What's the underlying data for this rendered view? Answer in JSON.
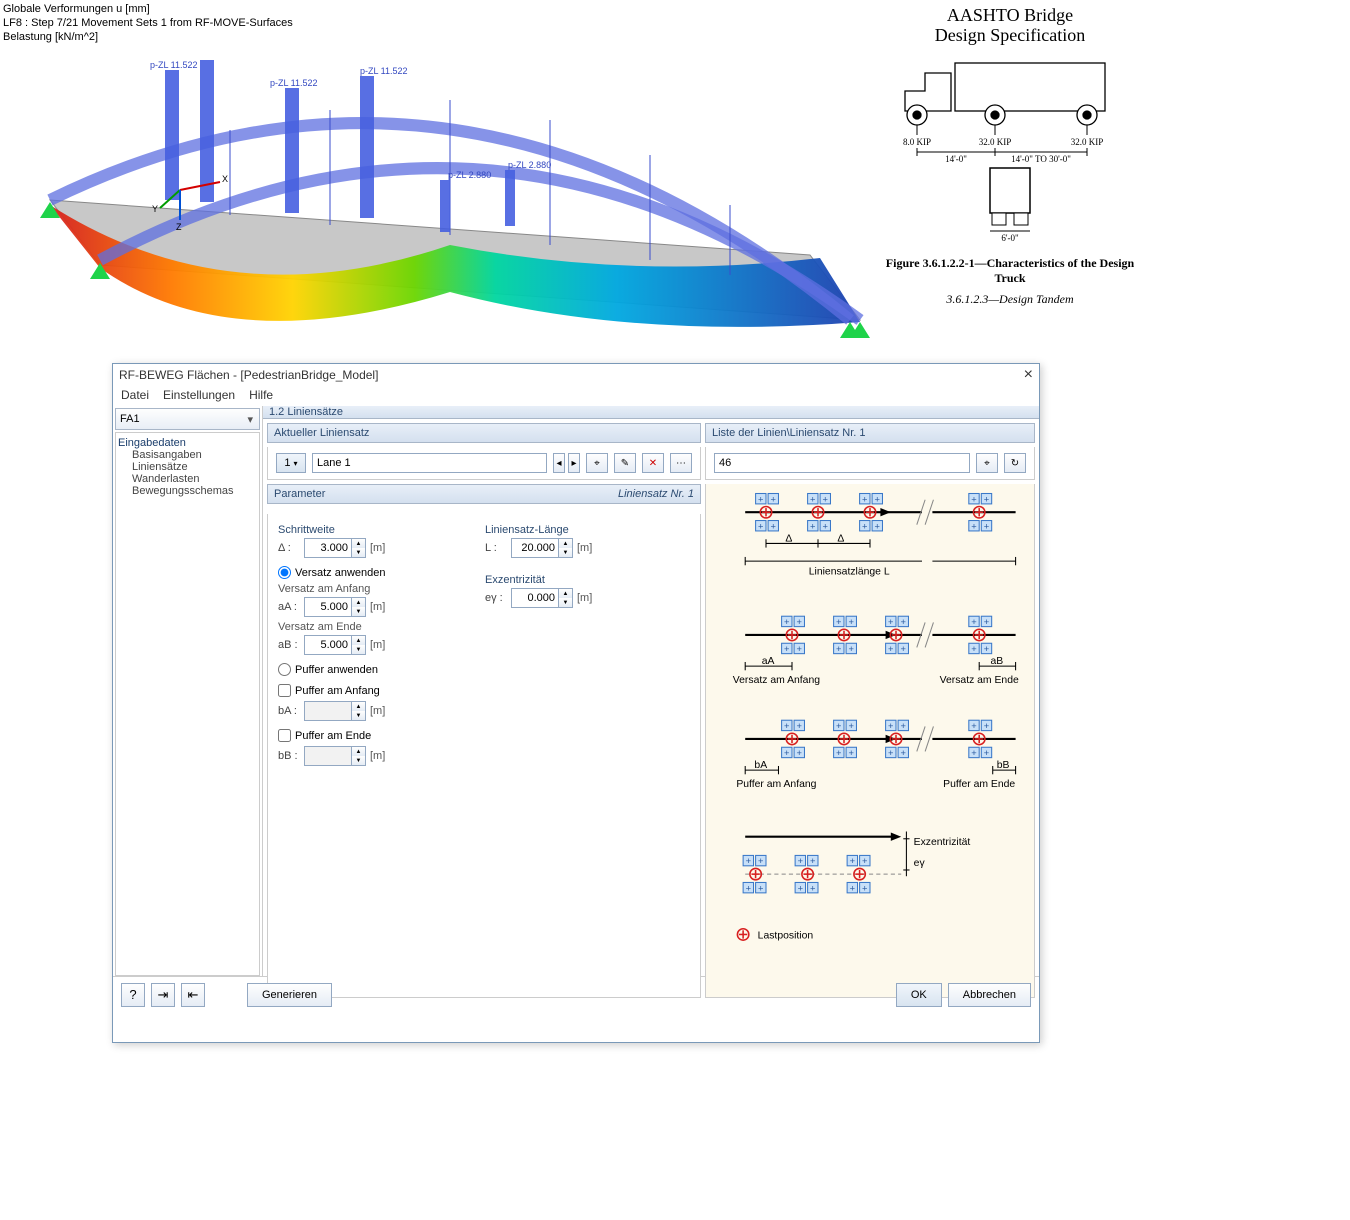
{
  "viz_labels": {
    "l1": "Globale Verformungen u [mm]",
    "l2": "LF8 : Step 7/21 Movement Sets 1 from RF-MOVE-Surfaces",
    "l3": "Belastung [kN/m^2]"
  },
  "bridge_loads": [
    "p-ZL 11.522",
    "p-ZL 11.522",
    "p-ZL 11.522",
    "p-ZL 11.522",
    "p-ZL 2.880",
    "p-ZL 2.880"
  ],
  "aashto": {
    "title1": "AASHTO Bridge",
    "title2": "Design Specification",
    "axle1": "8.0 KIP",
    "axle2": "32.0 KIP",
    "axle3": "32.0 KIP",
    "span1": "14'-0\"",
    "span2": "14'-0\"  TO  30'-0\"",
    "rear_width": "6'-0\"",
    "fig_caption": "Figure 3.6.1.2.2-1—Characteristics of the Design Truck",
    "sub_caption": "3.6.1.2.3—Design Tandem"
  },
  "dialog": {
    "title": "RF-BEWEG Flächen - [PedestrianBridge_Model]",
    "menu": [
      "Datei",
      "Einstellungen",
      "Hilfe"
    ],
    "fa": "FA1",
    "tree_root": "Eingabedaten",
    "tree_items": [
      "Basisangaben",
      "Liniensätze",
      "Wanderlasten",
      "Bewegungsschemas"
    ],
    "panel_title": "1.2 Liniensätze",
    "section_current": "Aktueller Liniensatz",
    "lane_idx": "1",
    "lane_name": "Lane 1",
    "section_param": "Parameter",
    "param_setno": "Liniensatz Nr. 1",
    "stepwidth": "Schrittweite",
    "delta": "Δ :",
    "delta_val": "3.000",
    "m": "[m]",
    "lensection": "Liniensatz-Länge",
    "L": "L :",
    "L_val": "20.000",
    "ecc": "Exzentrizität",
    "ey": "eγ :",
    "ey_val": "0.000",
    "opt_offset": "Versatz anwenden",
    "off_start": "Versatz am Anfang",
    "aA": "aA :",
    "aA_val": "5.000",
    "off_end": "Versatz am Ende",
    "aB": "aB :",
    "aB_val": "5.000",
    "opt_buffer": "Puffer anwenden",
    "buf_start": "Puffer am Anfang",
    "bA": "bA :",
    "buf_end": "Puffer am Ende",
    "bB": "bB :",
    "section_list": "Liste der Linien\\Liniensatz Nr. 1",
    "list_val": "46",
    "diagram_labels": {
      "delta": "Δ",
      "len": "Liniensatzlänge L",
      "aA": "aA",
      "aB": "aB",
      "vstart": "Versatz am Anfang",
      "vend": "Versatz am Ende",
      "bA": "bA",
      "bB": "bB",
      "pstart": "Puffer am Anfang",
      "pend": "Puffer am Ende",
      "ecc": "Exzentrizität",
      "ey": "eγ",
      "lastpos": "Lastposition"
    },
    "generate": "Generieren",
    "ok": "OK",
    "cancel": "Abbrechen"
  }
}
